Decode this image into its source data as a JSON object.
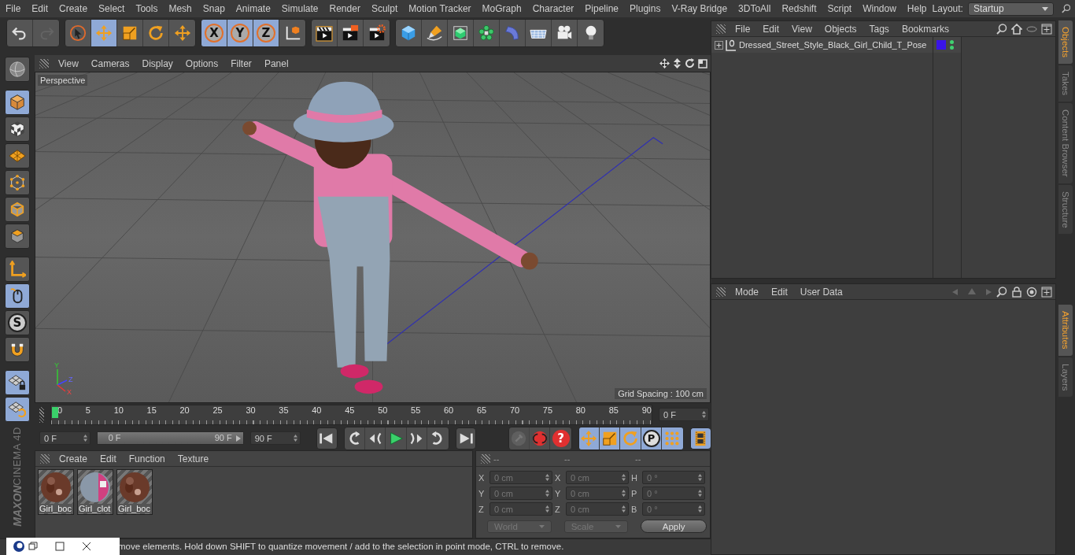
{
  "menu_bar": {
    "items": [
      "File",
      "Edit",
      "Create",
      "Select",
      "Tools",
      "Mesh",
      "Snap",
      "Animate",
      "Simulate",
      "Render",
      "Sculpt",
      "Motion Tracker",
      "MoGraph",
      "Character",
      "Pipeline",
      "Plugins",
      "V-Ray Bridge",
      "3DToAll",
      "Redshift",
      "Script",
      "Window",
      "Help"
    ],
    "layout_label": "Layout:",
    "layout_value": "Startup"
  },
  "top_toolbar": [
    {
      "selected": false,
      "disabled": false
    },
    {
      "selected": false,
      "disabled": true
    },
    {
      "selected": false,
      "disabled": false
    },
    {
      "selected": true,
      "disabled": false
    },
    {
      "selected": false,
      "disabled": false
    },
    {
      "selected": false,
      "disabled": false
    },
    {
      "selected": false,
      "disabled": false
    },
    {
      "selected": true,
      "disabled": false,
      "label": "X"
    },
    {
      "selected": true,
      "disabled": false,
      "label": "Y"
    },
    {
      "selected": true,
      "disabled": false,
      "label": "Z"
    },
    {
      "selected": false,
      "disabled": false
    },
    {
      "selected": false,
      "disabled": false
    },
    {
      "selected": false,
      "disabled": false
    },
    {
      "selected": false,
      "disabled": false
    },
    {
      "selected": false,
      "disabled": false
    },
    {
      "selected": false,
      "disabled": false
    },
    {
      "selected": false,
      "disabled": false
    },
    {
      "selected": false,
      "disabled": false
    },
    {
      "selected": false,
      "disabled": false
    },
    {
      "selected": false,
      "disabled": false
    },
    {
      "selected": false,
      "disabled": false
    },
    {
      "selected": false,
      "disabled": false
    }
  ],
  "left_toolbar": [
    {
      "selected": false
    },
    {
      "selected": true
    },
    {
      "selected": false
    },
    {
      "selected": false
    },
    {
      "selected": false
    },
    {
      "selected": false
    },
    {
      "selected": false
    },
    {
      "selected": false
    },
    {
      "selected": true
    },
    {
      "selected": false,
      "label": "S"
    },
    {
      "selected": false
    },
    {
      "selected": true
    },
    {
      "selected": true
    }
  ],
  "brand": [
    "MAXON",
    "CINEMA 4D"
  ],
  "viewport": {
    "menu": [
      "View",
      "Cameras",
      "Display",
      "Options",
      "Filter",
      "Panel"
    ],
    "camera": "Perspective",
    "grid_spacing": "Grid Spacing : 100 cm",
    "axes": [
      "Y",
      "Z",
      "X"
    ]
  },
  "timeline": {
    "ticks": [
      "0",
      "5",
      "10",
      "15",
      "20",
      "25",
      "30",
      "35",
      "40",
      "45",
      "50",
      "55",
      "60",
      "65",
      "70",
      "75",
      "80",
      "85",
      "90"
    ],
    "level": 0,
    "current_frame": "0 F",
    "start": "0 F",
    "range": {
      "start": "0 F",
      "end": "90 F",
      "level": 1
    },
    "end": "90 F"
  },
  "transport": [
    {
      "selected": false
    },
    {
      "selected": false
    },
    {
      "selected": false
    },
    {
      "selected": false
    },
    {
      "selected": false
    },
    {
      "selected": false
    },
    {
      "selected": false
    }
  ],
  "record_buttons": [
    {
      "disabled": true
    },
    {
      "disabled": false
    },
    {
      "disabled": false,
      "label": "?"
    }
  ],
  "key_buttons": [
    {
      "selected": true
    },
    {
      "selected": true
    },
    {
      "selected": true
    },
    {
      "selected": true,
      "label": "P"
    },
    {
      "selected": true
    }
  ],
  "timeline_button": {
    "selected": true
  },
  "materials": {
    "menu": [
      "Create",
      "Edit",
      "Function",
      "Texture"
    ],
    "items": [
      {
        "name": "Girl_boc",
        "kind": "skin"
      },
      {
        "name": "Girl_clot",
        "kind": "cloth"
      },
      {
        "name": "Girl_boc",
        "kind": "skin"
      }
    ]
  },
  "coordinates": {
    "headers": [
      "--",
      "--",
      "--"
    ],
    "rows": [
      {
        "axis": "X",
        "position": "0 cm",
        "size_axis": "X",
        "size": "0 cm",
        "rot_axis": "H",
        "rotation": "0 °"
      },
      {
        "axis": "Y",
        "position": "0 cm",
        "size_axis": "Y",
        "size": "0 cm",
        "rot_axis": "P",
        "rotation": "0 °"
      },
      {
        "axis": "Z",
        "position": "0 cm",
        "size_axis": "Z",
        "size": "0 cm",
        "rot_axis": "B",
        "rotation": "0 °"
      }
    ],
    "mode": "World",
    "size_mode": "Scale",
    "apply": "Apply"
  },
  "status_bar": {
    "text": "move elements. Hold down SHIFT to quantize movement / add to the selection in point mode, CTRL to remove."
  },
  "object_manager": {
    "menu": [
      "File",
      "Edit",
      "View",
      "Objects",
      "Tags",
      "Bookmarks"
    ],
    "objects": [
      {
        "name": "Dressed_Street_Style_Black_Girl_Child_T_Pose",
        "expanded": false,
        "color": "#3a14e8"
      }
    ]
  },
  "attribute_manager": {
    "menu": [
      "Mode",
      "Edit",
      "User Data"
    ]
  },
  "side_tabs_top": [
    {
      "label": "Objects",
      "selected": true
    },
    {
      "label": "Takes",
      "selected": false
    },
    {
      "label": "Content Browser",
      "selected": false
    },
    {
      "label": "Structure",
      "selected": false
    }
  ],
  "side_tabs_bottom": [
    {
      "label": "Attributes",
      "selected": true
    },
    {
      "label": "Layers",
      "selected": false
    }
  ]
}
